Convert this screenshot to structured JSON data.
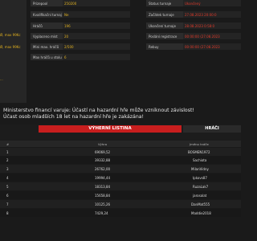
{
  "left_panel": {
    "items": [
      "",
      "Ø, max 99Kc",
      "Ø, max 99Kc"
    ],
    "dots": "..."
  },
  "info_table_a": [
    {
      "label": "Prizepool",
      "value": "250200",
      "accent": false
    },
    {
      "label": "Kvalifikační turnaj",
      "value": "Ne",
      "accent": false
    },
    {
      "label": "Hráčů",
      "value": "196",
      "accent": false
    },
    {
      "label": "Vyplaceno míst",
      "value": "20",
      "accent": false
    },
    {
      "label": "Mini max. hráčů",
      "value": "2/500",
      "accent": false
    },
    {
      "label": "Max hráčů u stolu",
      "value": "6",
      "accent": false
    }
  ],
  "info_table_b": [
    {
      "label": "Status turnaje",
      "value": "Ukončený",
      "accent": true
    },
    {
      "label": "Začátek turnaje",
      "value": "27.08.2023 20:00:0",
      "accent": true
    },
    {
      "label": "Ukončení turnaje",
      "value": "28.08.2023 0:58:0",
      "accent": true
    },
    {
      "label": "Poslání registrace",
      "value": "00:00:00 (27.08.2023",
      "accent": true
    },
    {
      "label": "Rebuy",
      "value": "00:00:00 (27.08.2023",
      "accent": true
    }
  ],
  "warning": {
    "line1": "Ministerstvo financí varuje: Účastí na hazardní hře může vzniknout závislost!",
    "line2": "Účast osob mladších 18 let na hazardní hře je zakázána!"
  },
  "tabs": {
    "main": "VÝHERNÍ LISTINA",
    "players": "HRÁČI"
  },
  "leaderboard": {
    "headers": {
      "col1": "#",
      "col2": "Výhra",
      "col3": "Jméno hráče"
    },
    "rows": [
      {
        "rank": "1",
        "win": "69069,52",
        "name": "BOSMEN1972"
      },
      {
        "rank": "2",
        "win": "39332,88",
        "name": "Sachiota"
      },
      {
        "rank": "3",
        "win": "26762,00",
        "name": "MilanVidny"
      },
      {
        "rank": "4",
        "win": "19994,44",
        "name": "Ipkovs87"
      },
      {
        "rank": "5",
        "win": "18313,84",
        "name": "RuzaLak7"
      },
      {
        "rank": "6",
        "win": "15658,84",
        "name": "jarosalat"
      },
      {
        "rank": "7",
        "win": "10125,26",
        "name": "DanMat555"
      },
      {
        "rank": "8",
        "win": "7429,24",
        "name": "Maddie2018"
      }
    ]
  }
}
